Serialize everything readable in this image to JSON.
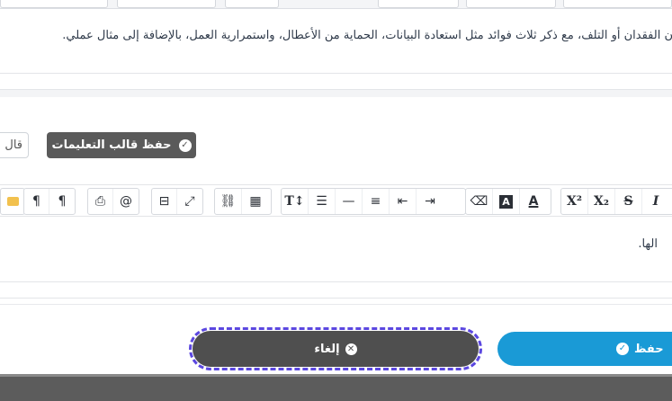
{
  "question": {
    "text": "ن الفقدان أو التلف، مع ذكر ثلاث فوائد مثل استعادة البيانات، الحماية من الأعطال، واستمرارية العمل، بالإضافة إلى مثال عملي."
  },
  "template_actions": {
    "save_template_label": "حفظ قالب التعليمات",
    "template_partial_label": "قال"
  },
  "toolbar": {
    "buttons": [
      {
        "name": "italic",
        "glyph": "I"
      },
      {
        "name": "strikethrough",
        "glyph": "S"
      },
      {
        "name": "subscript",
        "glyph": "X₂"
      },
      {
        "name": "superscript",
        "glyph": "X²"
      },
      {
        "name": "font-color",
        "glyph": "A"
      },
      {
        "name": "background-color",
        "glyph": "A"
      },
      {
        "name": "clear-format",
        "glyph": "⌫"
      },
      {
        "name": "indent",
        "glyph": "⇥"
      },
      {
        "name": "outdent",
        "glyph": "⇤"
      },
      {
        "name": "align",
        "glyph": "≡"
      },
      {
        "name": "horizontal-rule",
        "glyph": "—"
      },
      {
        "name": "ordered-list",
        "glyph": "☰"
      },
      {
        "name": "text-size",
        "glyph": "T↕"
      },
      {
        "name": "table",
        "glyph": "▦"
      },
      {
        "name": "link",
        "glyph": "🔗"
      },
      {
        "name": "fullscreen",
        "glyph": "⤢"
      },
      {
        "name": "code-view",
        "glyph": "⊟"
      },
      {
        "name": "mention",
        "glyph": "@"
      },
      {
        "name": "print",
        "glyph": "⎙"
      },
      {
        "name": "ltr",
        "glyph": "¶"
      },
      {
        "name": "rtl",
        "glyph": "¶"
      }
    ]
  },
  "editor": {
    "content": "الها."
  },
  "footer": {
    "cancel_label": "إلغاء",
    "save_label": "حفظ"
  }
}
